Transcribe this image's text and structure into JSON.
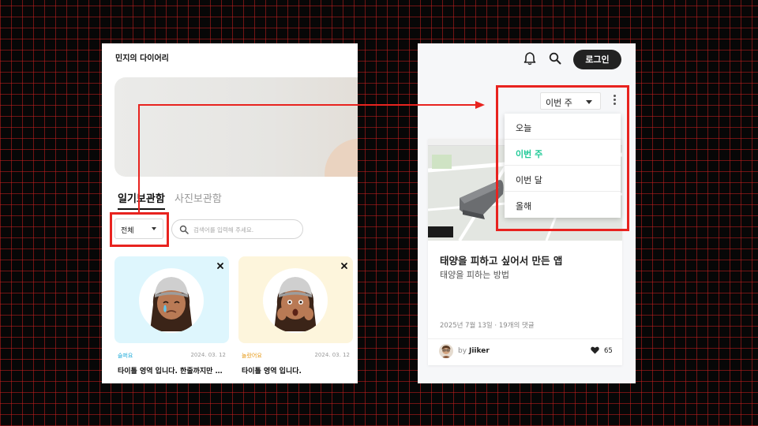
{
  "diary": {
    "app_title": "민지의 다이어리",
    "tabs": [
      "일기보관함",
      "사진보관함"
    ],
    "filter": {
      "selected": "전체"
    },
    "search": {
      "placeholder": "검색어를 입력해 주세요.",
      "value": ""
    },
    "cards": [
      {
        "mood": "슬퍼요",
        "date": "2024. 03. 12",
        "title": "타이틀 영역 입니다. 한줄까지만 노...",
        "mood_color": "#1aa9d8",
        "bg": "#def6fd"
      },
      {
        "mood": "놀랐어요",
        "date": "2024. 03. 12",
        "title": "타이틀 영역 입니다.",
        "mood_color": "#e69a17",
        "bg": "#fdf5dc"
      }
    ]
  },
  "blog": {
    "header": {
      "login_label": "로그인",
      "icons": [
        "bell-icon",
        "search-icon"
      ]
    },
    "period_select": {
      "selected": "이번 주"
    },
    "period_options": [
      {
        "label": "오늘",
        "active": false
      },
      {
        "label": "이번 주",
        "active": true
      },
      {
        "label": "이번 달",
        "active": false
      },
      {
        "label": "올해",
        "active": false
      }
    ],
    "post": {
      "title": "태양을 피하고 싶어서 만든 앱",
      "subtitle": "태양을 피하는 방법",
      "meta": "2025년 7월 13일 · 19개의 댓글",
      "by": "by",
      "author": "Jiiker",
      "likes": "65"
    }
  },
  "colors": {
    "highlight": "#e8231f",
    "active_option": "#20c997"
  }
}
